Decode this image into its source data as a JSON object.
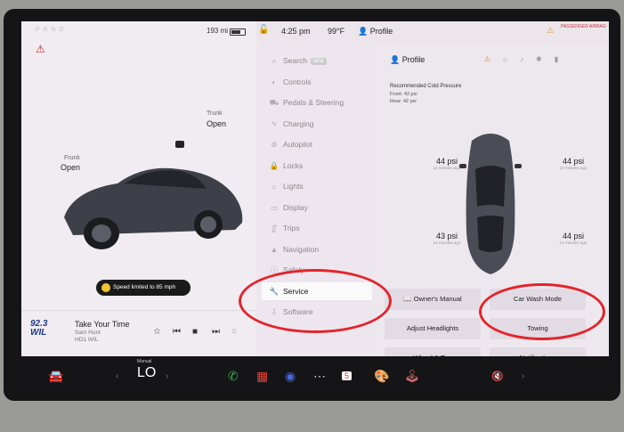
{
  "topbar": {
    "gear": "P R N D",
    "range": "193 mi",
    "time": "4:25 pm",
    "temperature": "99°F",
    "profile": "Profile",
    "airbag": "PASSENGER AIRBAG"
  },
  "vehicle": {
    "trunk_label": "Trunk",
    "trunk_value": "Open",
    "frunk_label": "Frunk",
    "frunk_value": "Open",
    "speed_limit": "Speed limited to 85 mph"
  },
  "media": {
    "station_logo_top": "92.3",
    "station_logo_bottom": "WIL",
    "song": "Take Your Time",
    "artist": "Sam Hunt",
    "station": "HD1 WIL"
  },
  "menu": {
    "items": [
      {
        "label": "Search",
        "icon": "search-icon",
        "badge": "NEW"
      },
      {
        "label": "Controls",
        "icon": "toggle-icon"
      },
      {
        "label": "Pedals & Steering",
        "icon": "car-icon"
      },
      {
        "label": "Charging",
        "icon": "bolt-icon"
      },
      {
        "label": "Autopilot",
        "icon": "steering-wheel-icon"
      },
      {
        "label": "Locks",
        "icon": "lock-icon"
      },
      {
        "label": "Lights",
        "icon": "sun-icon"
      },
      {
        "label": "Display",
        "icon": "display-icon"
      },
      {
        "label": "Trips",
        "icon": "trips-icon"
      },
      {
        "label": "Navigation",
        "icon": "navigation-icon"
      },
      {
        "label": "Safety",
        "icon": "safety-icon"
      },
      {
        "label": "Service",
        "icon": "wrench-icon"
      },
      {
        "label": "Software",
        "icon": "download-icon"
      }
    ],
    "selected": "Service"
  },
  "panel": {
    "profile": "Profile",
    "recommended_title": "Recommended Cold Pressure",
    "front": "Front: 42 psi",
    "rear": "Rear: 42 psi",
    "tires": {
      "front_left": {
        "value": "44 psi",
        "age": "14 minutes ago"
      },
      "front_right": {
        "value": "44 psi",
        "age": "14 minutes ago"
      },
      "rear_left": {
        "value": "43 psi",
        "age": "14 minutes ago"
      },
      "rear_right": {
        "value": "44 psi",
        "age": "14 minutes ago"
      }
    },
    "buttons": {
      "owners_manual": "Owner's Manual",
      "car_wash": "Car Wash Mode",
      "headlights": "Adjust Headlights",
      "towing": "Towing",
      "wheel_tire": "Wheel & Tire",
      "notifications": "Notifications"
    }
  },
  "dock": {
    "climate_label": "Manual",
    "climate_value": "LO",
    "calendar_day": "5"
  },
  "colors": {
    "highlight_circle": "#e3242b",
    "warning": "#e08a1e",
    "seatbelt": "#d02020"
  }
}
